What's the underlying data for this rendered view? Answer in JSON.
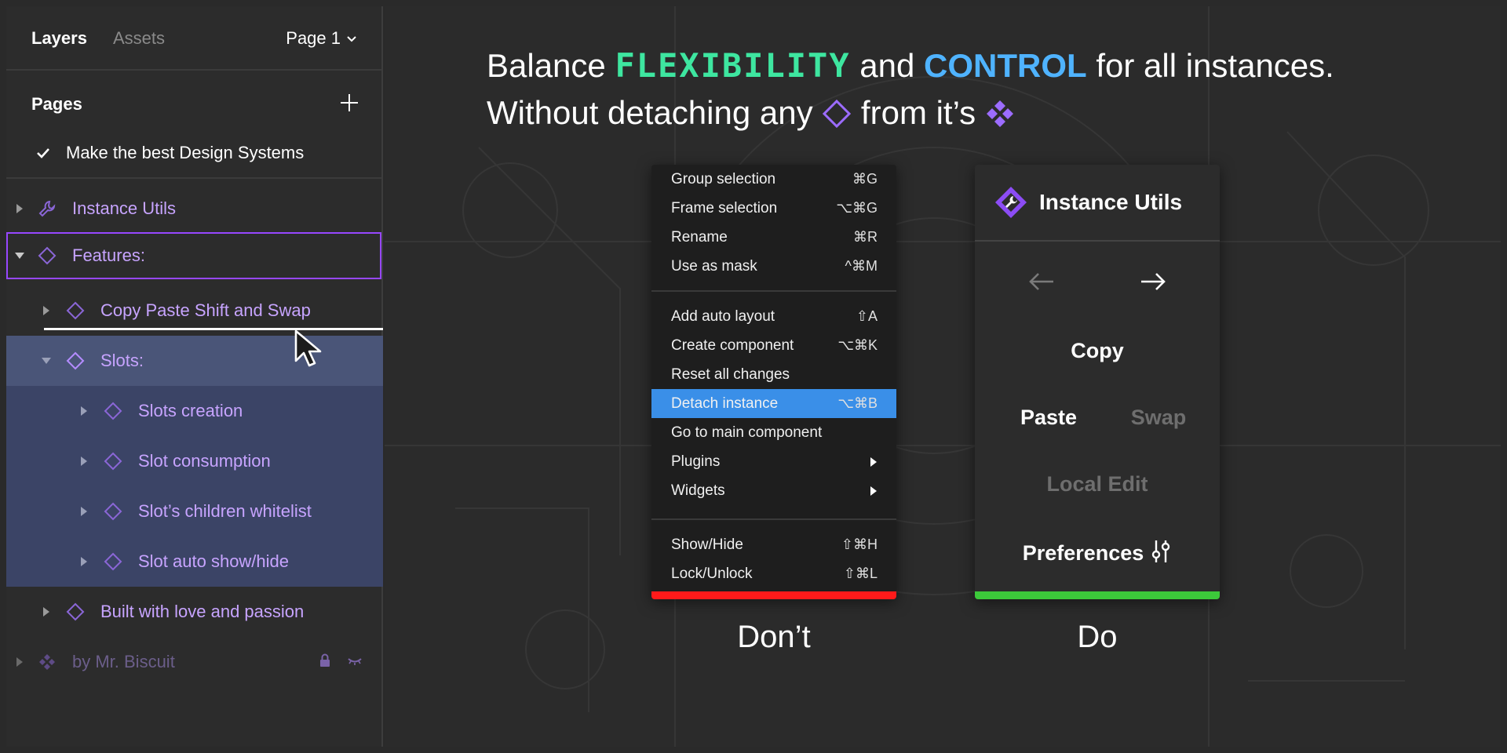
{
  "panel": {
    "tabs": {
      "layers": "Layers",
      "assets": "Assets"
    },
    "page_select": "Page 1",
    "pages_title": "Pages",
    "current_page": "Make the best Design Systems",
    "layers": [
      {
        "label": "Instance Utils"
      },
      {
        "label": "Features:"
      },
      {
        "label": "Copy Paste Shift and Swap"
      },
      {
        "label": "Slots:"
      },
      {
        "label": "Slots creation"
      },
      {
        "label": "Slot consumption"
      },
      {
        "label": "Slot’s children whitelist"
      },
      {
        "label": "Slot auto show/hide"
      },
      {
        "label": "Built with love and passion"
      },
      {
        "label": "by Mr. Biscuit"
      }
    ]
  },
  "canvas": {
    "headline": {
      "line1_a": "Balance ",
      "line1_flex": "FLEXIBILITY",
      "line1_b": " and ",
      "line1_ctrl": "CONTROL",
      "line1_c": " for all instances.",
      "line2_a": "Without detaching any ",
      "line2_b": " from it’s "
    },
    "menu": {
      "items": [
        {
          "label": "Group selection",
          "shortcut": "⌘G"
        },
        {
          "label": "Frame selection",
          "shortcut": "⌥⌘G"
        },
        {
          "label": "Rename",
          "shortcut": "⌘R"
        },
        {
          "label": "Use as mask",
          "shortcut": "^⌘M"
        },
        {
          "label": "Add auto layout",
          "shortcut": "⇧A"
        },
        {
          "label": "Create component",
          "shortcut": "⌥⌘K"
        },
        {
          "label": "Reset all changes",
          "shortcut": ""
        },
        {
          "label": "Detach instance",
          "shortcut": "⌥⌘B"
        },
        {
          "label": "Go to main component",
          "shortcut": ""
        },
        {
          "label": "Plugins",
          "shortcut": ""
        },
        {
          "label": "Widgets",
          "shortcut": ""
        },
        {
          "label": "Show/Hide",
          "shortcut": "⇧⌘H"
        },
        {
          "label": "Lock/Unlock",
          "shortcut": "⇧⌘L"
        }
      ]
    },
    "plugin": {
      "title": "Instance Utils",
      "copy": "Copy",
      "paste": "Paste",
      "swap": "Swap",
      "local_edit": "Local Edit",
      "preferences": "Preferences"
    },
    "captions": {
      "dont": "Don’t",
      "do": "Do"
    }
  },
  "colors": {
    "accent_purple": "#9747ff",
    "flex_green": "#3ee6a0",
    "control_blue": "#4fb3ff",
    "menu_active": "#3a8fe8",
    "bar_red": "#ff1a1a",
    "bar_green": "#3cc93a"
  }
}
